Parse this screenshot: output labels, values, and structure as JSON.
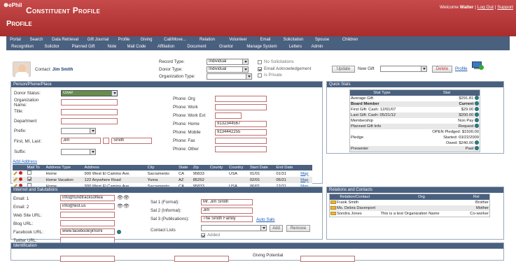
{
  "header": {
    "logo": "ePhil",
    "app_title": "Constituent Profile",
    "page_title": "Profile",
    "welcome_prefix": "Welcome",
    "user": "Walter",
    "logout": "Log Out",
    "support": "Support",
    "sep": "|"
  },
  "nav": {
    "row1": [
      "Portal",
      "Search",
      "Data Retrieval",
      "Gift Journal",
      "Profile",
      "Giving",
      "Call/Move...",
      "Relation",
      "Volunteer",
      "Email",
      "Solicitation",
      "Spouse",
      "Children"
    ],
    "row2": [
      "Recognition",
      "Solicitor",
      "Planned Gift",
      "Note",
      "Mail Code",
      "Affiliation",
      "Document",
      "Grantor",
      "Manage System",
      "Letters",
      "Admin"
    ]
  },
  "contact": {
    "label": "Contact:",
    "name": "Jim Smith"
  },
  "record": {
    "record_type_label": "Record Type:",
    "record_type": "Individual",
    "donor_type_label": "Donor Type:",
    "donor_type": "Individual",
    "org_type_label": "Organization Type:",
    "org_type": "",
    "no_solicit": "No Solicitations",
    "email_ack": "Email Acknowledgement",
    "is_private": "Is Private",
    "update": "Update",
    "new_gift_label": "New Gift",
    "new_gift": "",
    "delete": "Delete",
    "profile": "Profile"
  },
  "person": {
    "title": "Person/Phone/Place",
    "donor_status_label": "Donor Status:",
    "donor_status": "Giver",
    "org_name_label": "Organization Name:",
    "title_label": "Title:",
    "department_label": "Department",
    "prefix_label": "Prefix:",
    "name_label": "First, MI, Last:",
    "first": "Jim",
    "mi": "",
    "last": "Smith",
    "suffix_label": "Suffix:",
    "phone_org": "Phone: Org",
    "phone_work": "Phone: Work",
    "phone_work_ext": "Phone: Work Ext",
    "phone_home": "Phone: Home",
    "phone_home_val": "9132344567",
    "phone_mobile": "Phone: Mobile",
    "phone_mobile_val": "9134442255",
    "phone_fax": "Phone: Fax",
    "phone_other": "Phone: Other",
    "add_address": "Add Address"
  },
  "addresses": {
    "headers": [
      "",
      "Mail To",
      "Address Type",
      "Address",
      "City",
      "State",
      "Zip",
      "County",
      "Country",
      "Start Date",
      "End Date",
      ""
    ],
    "rows": [
      {
        "type": "Home",
        "address": "900 West El Camino Ave.",
        "city": "Sacramento",
        "state": "CA",
        "zip": "95833",
        "county": "",
        "country": "USA",
        "start": "01/01",
        "end": "01/31",
        "map": "Map",
        "mail": false
      },
      {
        "type": "Home Vacation",
        "address": "122 Anywhere Road",
        "city": "Yuma",
        "state": "AZ",
        "zip": "85252",
        "county": "",
        "country": "",
        "start": "02/01",
        "end": "05/31",
        "map": "Map",
        "mail": true
      },
      {
        "type": "Home",
        "address": "900 West El Camino Ave.",
        "city": "Sacramento",
        "state": "CA",
        "zip": "95833",
        "county": "",
        "country": "USA",
        "start": "06/01",
        "end": "12/31",
        "map": "Map",
        "mail": false
      }
    ]
  },
  "quick_stats": {
    "title": "Quick Stats",
    "headers": [
      "Stat Type",
      "Stat"
    ],
    "rows": [
      {
        "type": "Average Gift",
        "stat": "$291.81",
        "bold": false
      },
      {
        "type": "Board Member",
        "stat": "Current",
        "bold": true
      },
      {
        "type": "First Gift: Cash: 12/01/07",
        "stat": "$29.00",
        "bold": false
      },
      {
        "type": "Last Gift: Cash: 05/21/12",
        "stat": "$200.00",
        "bold": false
      },
      {
        "type": "Membership",
        "stat": "Non Pay",
        "bold": false
      },
      {
        "type": "Planned Gift Info",
        "stat": "Request",
        "bold": false
      },
      {
        "type": "Pledge",
        "stat": "OPEN Pledged: $1500.00\nStarted: 03/22/2009\nOwed: $240.00",
        "bold": false
      },
      {
        "type": "Presenter",
        "stat": "Past",
        "bold": false
      }
    ]
  },
  "internet": {
    "title": "Internet and Salutations",
    "email1_label": "Email: 1",
    "email1": "info@fundtracksoftwa",
    "email2_label": "Email: 2",
    "email2": "info@test.us",
    "web_label": "Web Site URL:",
    "blog_label": "Blog URL:",
    "facebook_label": "Facebook URL:",
    "facebook": "www.facebook/jimsmi",
    "twitter_label": "Twitter URL:",
    "sal1_label": "Sal 1 (Formal):",
    "sal1": "Mr. Jim Smith",
    "sal2_label": "Sal 2 (Informal):",
    "sal2": "Jim",
    "sal3_label": "Sal 3 (Publications):",
    "sal3": "The Smith Family",
    "auto_sals": "Auto Sals",
    "contact_lists_label": "Contact Lists",
    "add": "Add",
    "remove": "Remove",
    "added": "Added"
  },
  "relations": {
    "title": "Relations and Contacts",
    "headers": [
      "Relation/Contact",
      "Org",
      "Rel"
    ],
    "rows": [
      {
        "name": "Frank Smith",
        "org": "",
        "rel": "Brother"
      },
      {
        "name": "Ms. Debra Davenport",
        "org": "",
        "rel": "Mother"
      },
      {
        "name": "Sondra Jones",
        "org": "This is a test Organization Name",
        "rel": "Co-worker"
      }
    ]
  },
  "identification": {
    "title": "Identification",
    "giving_potential": "Giving Potential"
  }
}
